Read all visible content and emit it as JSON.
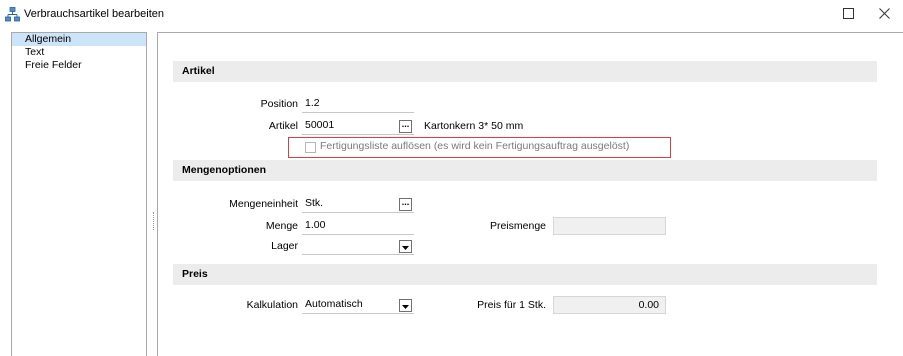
{
  "window": {
    "title": "Verbrauchsartikel bearbeiten",
    "app_icon": "hierarchy-icon",
    "maximize_icon": "maximize-icon",
    "close_icon": "close-icon"
  },
  "nav": {
    "items": [
      {
        "label": "Allgemein",
        "selected": true
      },
      {
        "label": "Text",
        "selected": false
      },
      {
        "label": "Freie Felder",
        "selected": false
      }
    ]
  },
  "sections": {
    "artikel": "Artikel",
    "mengenoptionen": "Mengenoptionen",
    "preis": "Preis"
  },
  "fields": {
    "position": {
      "label": "Position",
      "value": "1.2"
    },
    "artikel": {
      "label": "Artikel",
      "value": "50001",
      "button": "...",
      "description": "Kartonkern 3* 50 mm"
    },
    "fertigungsliste": {
      "label": "Fertigungsliste auflösen (es wird kein Fertigungsauftrag ausgelöst)",
      "checked": false
    },
    "mengeneinheit": {
      "label": "Mengeneinheit",
      "value": "Stk.",
      "button": "..."
    },
    "menge": {
      "label": "Menge",
      "value": "1.00"
    },
    "preismenge": {
      "label": "Preismenge",
      "value": ""
    },
    "lager": {
      "label": "Lager",
      "value": ""
    },
    "kalkulation": {
      "label": "Kalkulation",
      "value": "Automatisch"
    },
    "preis_fuer": {
      "label": "Preis für 1 Stk.",
      "value": "0.00"
    }
  },
  "colors": {
    "highlight_border": "#e03c3c",
    "nav_selected": "#cce4f7",
    "section_bg": "#ececec"
  }
}
